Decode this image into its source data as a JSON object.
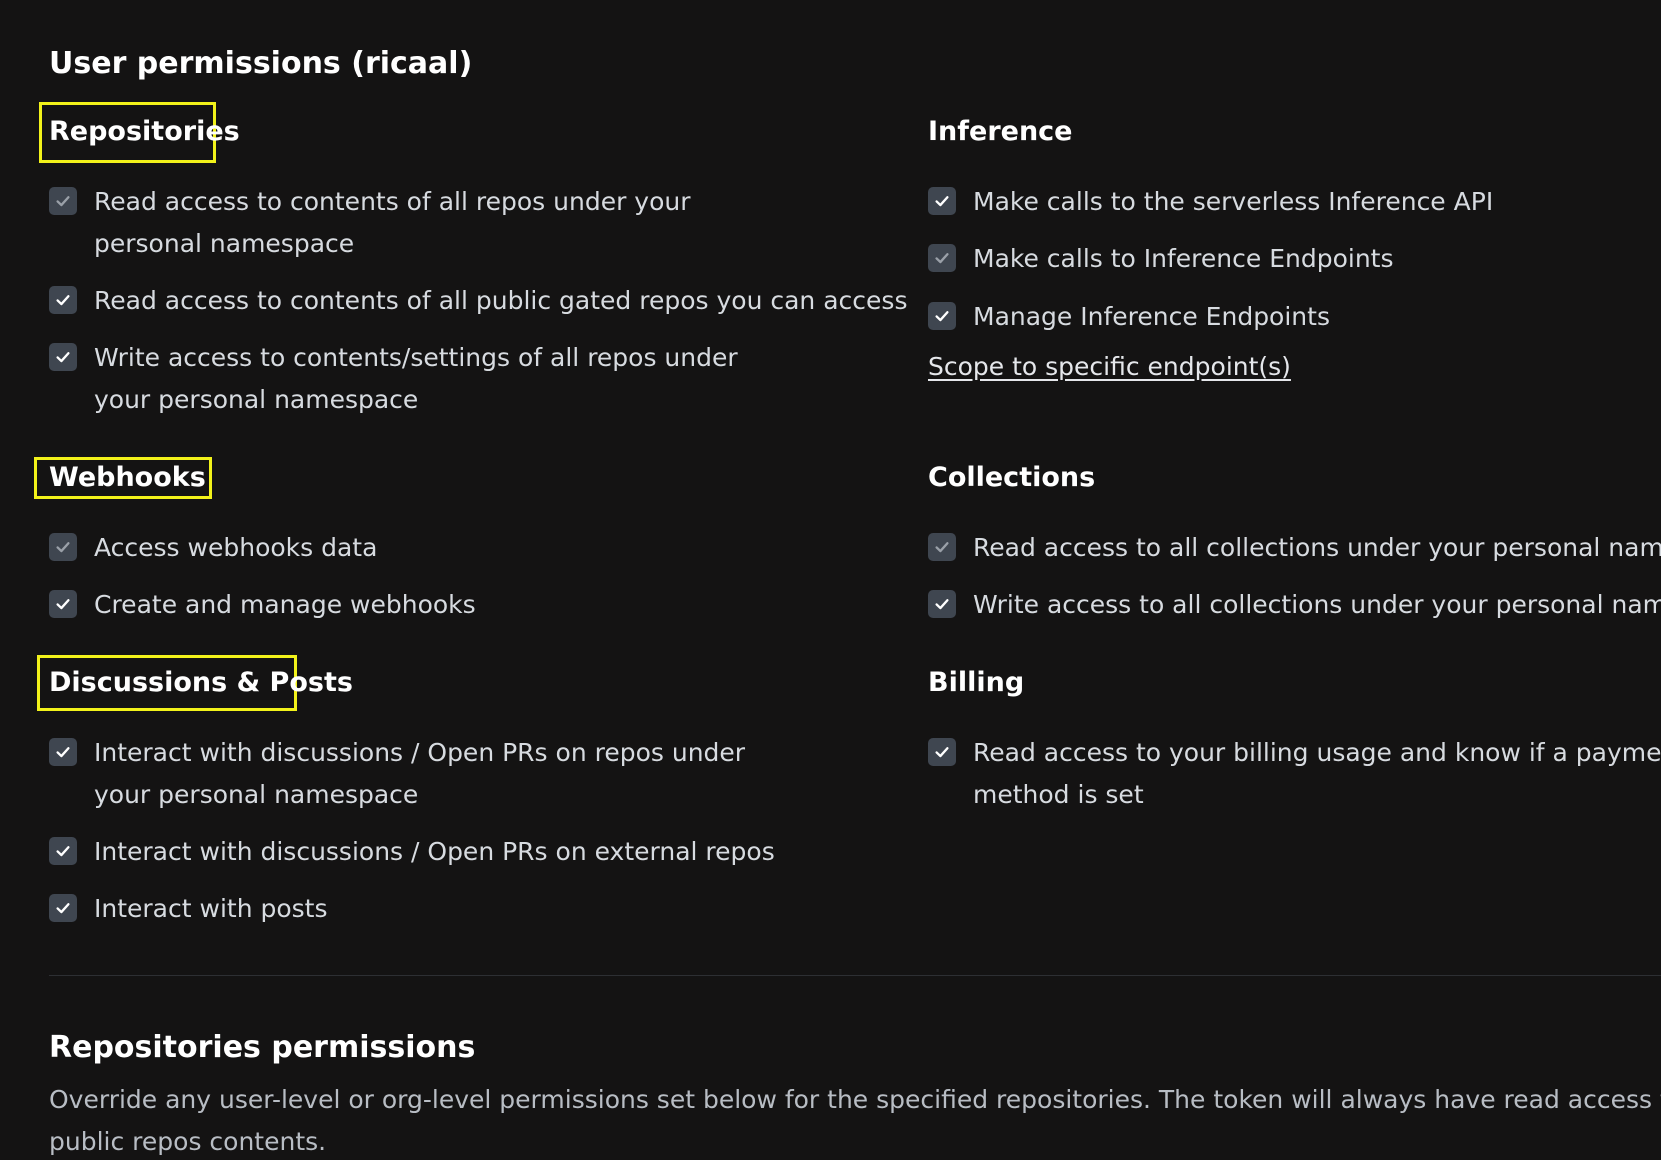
{
  "page_title": "User permissions (ricaal)",
  "colors": {
    "background": "#141313",
    "highlight": "#f2f21a",
    "checkbox_checked": "#3f4650",
    "checkbox_disabled": "#2f3338"
  },
  "sections": {
    "repositories": {
      "heading": "Repositories",
      "highlighted": true,
      "items": [
        {
          "label": "Read access to contents of all repos under your personal namespace",
          "checked": true,
          "disabled": true
        },
        {
          "label": "Read access to contents of all public gated repos you can access",
          "checked": true,
          "disabled": false
        },
        {
          "label": "Write access to contents/settings of all repos under your personal namespace",
          "checked": true,
          "disabled": false
        }
      ]
    },
    "webhooks": {
      "heading": "Webhooks",
      "highlighted": true,
      "items": [
        {
          "label": "Access webhooks data",
          "checked": true,
          "disabled": true
        },
        {
          "label": "Create and manage webhooks",
          "checked": true,
          "disabled": false
        }
      ]
    },
    "discussions": {
      "heading": "Discussions & Posts",
      "highlighted": true,
      "items": [
        {
          "label": "Interact with discussions / Open PRs on repos under your personal namespace",
          "checked": true,
          "disabled": false
        },
        {
          "label": "Interact with discussions / Open PRs on external repos",
          "checked": true,
          "disabled": false
        },
        {
          "label": "Interact with posts",
          "checked": true,
          "disabled": false
        }
      ]
    },
    "inference": {
      "heading": "Inference",
      "highlighted": false,
      "items": [
        {
          "label": "Make calls to the serverless Inference API",
          "checked": true,
          "disabled": false
        },
        {
          "label": "Make calls to Inference Endpoints",
          "checked": true,
          "disabled": true
        },
        {
          "label": "Manage Inference Endpoints",
          "checked": true,
          "disabled": false
        }
      ],
      "link_label": "Scope to specific endpoint(s)"
    },
    "collections": {
      "heading": "Collections",
      "highlighted": false,
      "items": [
        {
          "label": "Read access to all collections under your personal namespace",
          "checked": true,
          "disabled": true
        },
        {
          "label": "Write access to all collections under your personal namespace",
          "checked": true,
          "disabled": false
        }
      ]
    },
    "billing": {
      "heading": "Billing",
      "highlighted": false,
      "items": [
        {
          "label": "Read access to your billing usage and know if a payment method is set",
          "checked": true,
          "disabled": false
        }
      ]
    }
  },
  "repositories_permissions": {
    "title": "Repositories permissions",
    "description": "Override any user-level or org-level permissions set below for the specified repositories. The token will always have read access to all public repos contents."
  },
  "icons": {
    "checkbox": "check-icon"
  }
}
